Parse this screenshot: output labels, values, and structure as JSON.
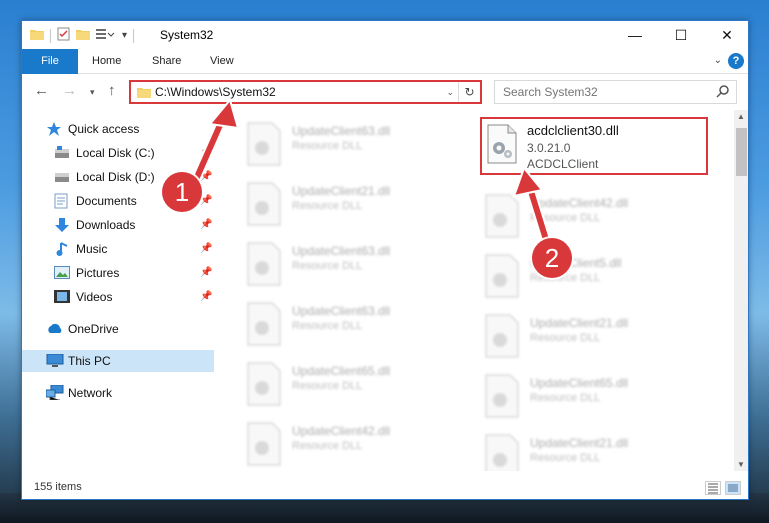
{
  "window": {
    "title": "System32",
    "controls": {
      "minimize": "—",
      "maximize": "☐",
      "close": "✕"
    }
  },
  "ribbon": {
    "tabs": [
      "File",
      "Home",
      "Share",
      "View"
    ],
    "expand_glyph": "⌄",
    "help_glyph": "?"
  },
  "nav": {
    "address_path": "C:\\Windows\\System32",
    "search_placeholder": "Search System32"
  },
  "sidebar": {
    "items": [
      {
        "label": "Quick access",
        "icon": "star-icon",
        "pinned": false
      },
      {
        "label": "Local Disk (C:)",
        "icon": "drive-icon",
        "pinned": true
      },
      {
        "label": "Local Disk (D:)",
        "icon": "drive-icon",
        "pinned": true
      },
      {
        "label": "Documents",
        "icon": "documents-icon",
        "pinned": true
      },
      {
        "label": "Downloads",
        "icon": "downloads-icon",
        "pinned": true
      },
      {
        "label": "Music",
        "icon": "music-icon",
        "pinned": true
      },
      {
        "label": "Pictures",
        "icon": "pictures-icon",
        "pinned": true
      },
      {
        "label": "Videos",
        "icon": "videos-icon",
        "pinned": true
      },
      {
        "label": "OneDrive",
        "icon": "onedrive-icon",
        "pinned": false
      },
      {
        "label": "This PC",
        "icon": "computer-icon",
        "pinned": false,
        "selected": true
      },
      {
        "label": "Network",
        "icon": "network-icon",
        "pinned": false
      }
    ]
  },
  "files": {
    "highlighted": {
      "name": "acdclclient30.dll",
      "version": "3.0.21.0",
      "description": "ACDCLClient"
    },
    "blurred_left": [
      {
        "name": "UpdateClient63.dll",
        "type": "Resource DLL"
      },
      {
        "name": "UpdateClient21.dll",
        "type": "Resource DLL"
      },
      {
        "name": "UpdateClient63.dll",
        "type": "Resource DLL"
      },
      {
        "name": "UpdateClient63.dll",
        "type": "Resource DLL"
      },
      {
        "name": "UpdateClient65.dll",
        "type": "Resource DLL"
      },
      {
        "name": "UpdateClient42.dll",
        "type": "Resource DLL"
      }
    ],
    "blurred_right": [
      {
        "name": "UpdateClient42.dll",
        "type": "Resource DLL"
      },
      {
        "name": "UpdateClient5.dll",
        "type": "Resource DLL"
      },
      {
        "name": "UpdateClient21.dll",
        "type": "Resource DLL"
      },
      {
        "name": "UpdateClient65.dll",
        "type": "Resource DLL"
      },
      {
        "name": "UpdateClient21.dll",
        "type": "Resource DLL"
      }
    ]
  },
  "status": {
    "item_count": "155 items"
  },
  "annotations": {
    "step1": "1",
    "step2": "2"
  },
  "colors": {
    "accent": "#1979ca",
    "highlight_border": "#d9383a",
    "selected_bg": "#cce4f7"
  }
}
